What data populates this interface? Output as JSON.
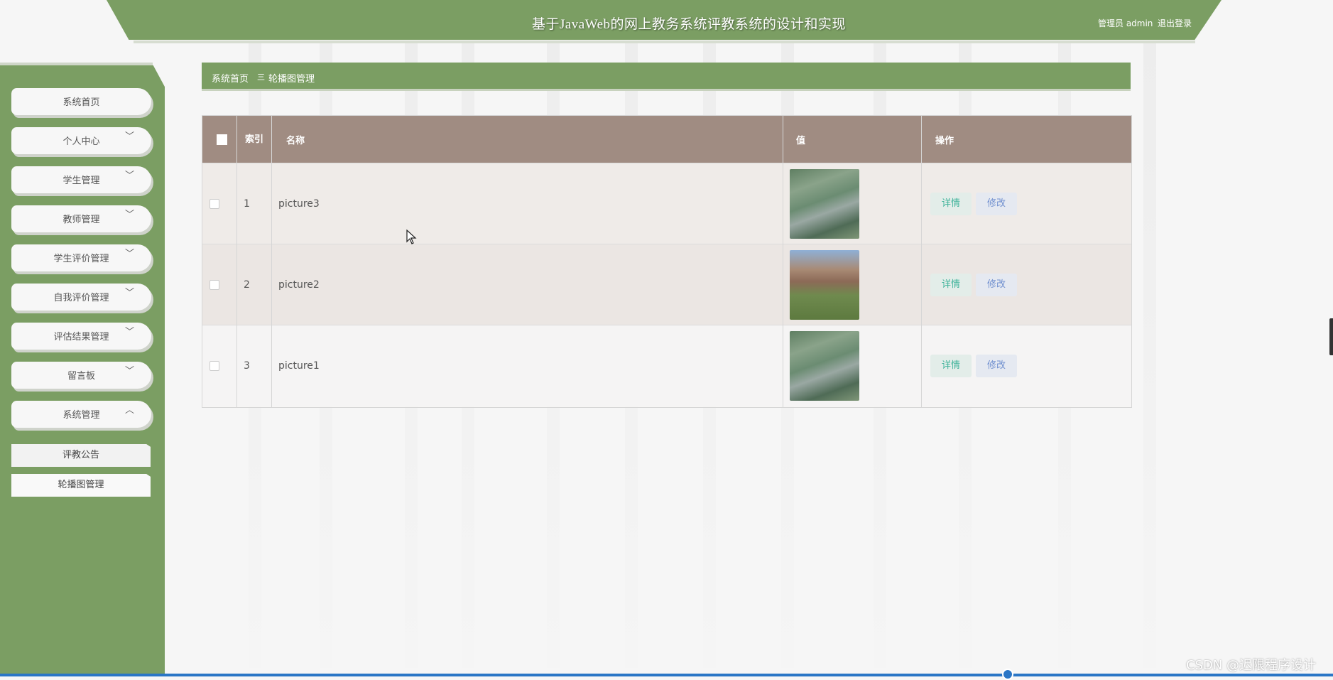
{
  "header": {
    "title": "基于JavaWeb的网上教务系统评教系统的设计和实现",
    "user_info": "管理员 admin",
    "logout": "退出登录"
  },
  "sidebar": {
    "items": [
      {
        "label": "系统首页",
        "chevron": ""
      },
      {
        "label": "个人中心",
        "chevron": "﹀"
      },
      {
        "label": "学生管理",
        "chevron": "﹀"
      },
      {
        "label": "教师管理",
        "chevron": "﹀"
      },
      {
        "label": "学生评价管理",
        "chevron": "﹀"
      },
      {
        "label": "自我评价管理",
        "chevron": "﹀"
      },
      {
        "label": "评估结果管理",
        "chevron": "﹀"
      },
      {
        "label": "留言板",
        "chevron": "﹀"
      },
      {
        "label": "系统管理",
        "chevron": "︿"
      }
    ],
    "sub_items": [
      {
        "label": "评教公告"
      },
      {
        "label": "轮播图管理"
      }
    ]
  },
  "breadcrumb": {
    "home": "系统首页",
    "separator": "三",
    "current": "轮播图管理"
  },
  "table": {
    "headers": {
      "index": "索引",
      "name": "名称",
      "value": "值",
      "actions": "操作"
    },
    "rows": [
      {
        "index": "1",
        "name": "picture3",
        "detail": "详情",
        "edit": "修改"
      },
      {
        "index": "2",
        "name": "picture2",
        "detail": "详情",
        "edit": "修改"
      },
      {
        "index": "3",
        "name": "picture1",
        "detail": "详情",
        "edit": "修改"
      }
    ]
  },
  "watermark": "CSDN @迟限程序设计",
  "colors": {
    "accent": "#7b9e63",
    "table_header": "#a08c82",
    "detail_text": "#3fb39a",
    "edit_text": "#6f8fcf"
  }
}
